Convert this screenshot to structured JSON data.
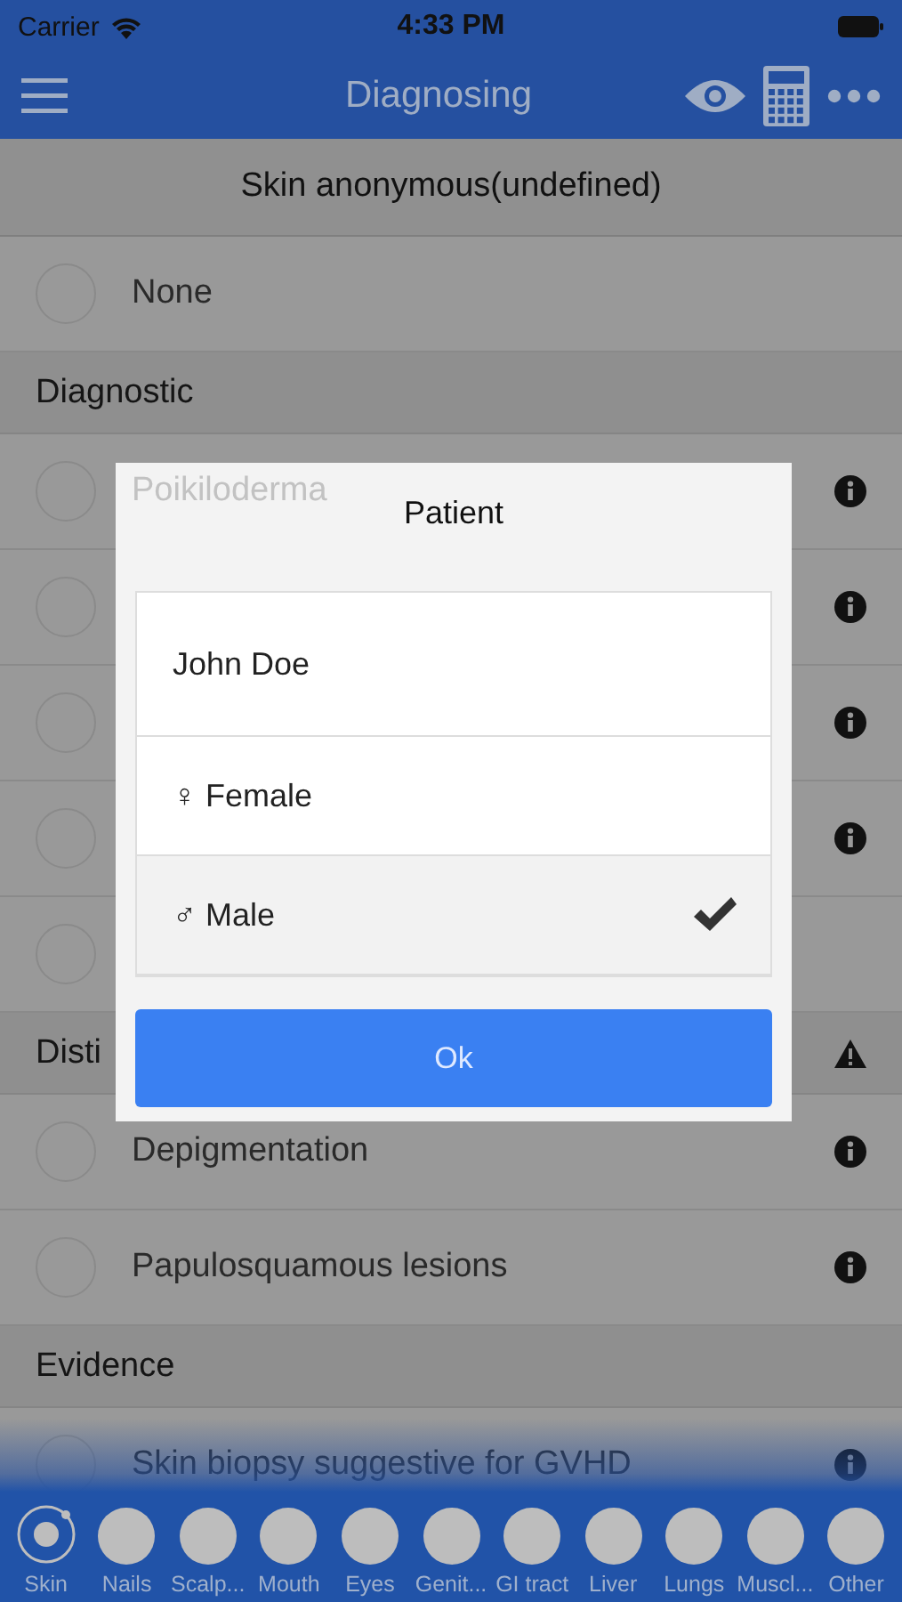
{
  "status_bar": {
    "carrier": "Carrier",
    "time": "4:33 PM"
  },
  "nav_bar": {
    "title": "Diagnosing"
  },
  "header": {
    "title": "Skin anonymous(undefined)"
  },
  "list": [
    {
      "kind": "option",
      "label": "None",
      "info": false,
      "checked": false
    },
    {
      "kind": "section",
      "label": "Diagnostic",
      "warning": false
    },
    {
      "kind": "option",
      "label": "Poikiloderma",
      "info": true,
      "checked": false
    },
    {
      "kind": "option",
      "info": true,
      "checked": false
    },
    {
      "kind": "option",
      "info": true,
      "checked": false
    },
    {
      "kind": "option",
      "info": true,
      "checked": false
    },
    {
      "kind": "option",
      "info": false,
      "checked": false
    },
    {
      "kind": "section",
      "label": "Disti",
      "warning": true
    },
    {
      "kind": "option",
      "label": "Depigmentation",
      "info": true,
      "checked": false
    },
    {
      "kind": "option",
      "label": "Papulosquamous lesions",
      "info": true,
      "checked": false
    },
    {
      "kind": "section",
      "label": "Evidence",
      "warning": false
    },
    {
      "kind": "option",
      "label": "Skin biopsy suggestive for GVHD",
      "info": true,
      "checked": false
    }
  ],
  "dialog": {
    "title": "Patient",
    "options": [
      {
        "kind": "name",
        "label": "John Doe"
      },
      {
        "kind": "gender",
        "label": "♀ Female",
        "selected": false
      },
      {
        "kind": "gender",
        "label": "♂ Male",
        "selected": true
      }
    ],
    "button": "Ok"
  },
  "tab_bar": [
    {
      "label": "Skin",
      "selected": true
    },
    {
      "label": "Nails",
      "selected": false
    },
    {
      "label": "Scalp...",
      "selected": false
    },
    {
      "label": "Mouth",
      "selected": false
    },
    {
      "label": "Eyes",
      "selected": false
    },
    {
      "label": "Genit...",
      "selected": false
    },
    {
      "label": "GI tract",
      "selected": false
    },
    {
      "label": "Liver",
      "selected": false
    },
    {
      "label": "Lungs",
      "selected": false
    },
    {
      "label": "Muscl...",
      "selected": false
    },
    {
      "label": "Other",
      "selected": false
    }
  ]
}
